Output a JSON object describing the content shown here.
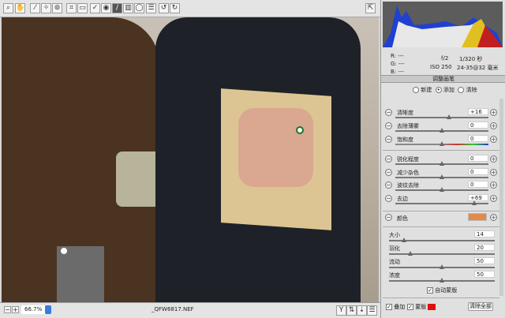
{
  "toolbar": {
    "tools": [
      "zoom",
      "hand",
      "white-balance",
      "color-sampler",
      "targeted-adjustment",
      "crop",
      "straighten",
      "spot-removal",
      "red-eye",
      "adjustment-brush",
      "graduated-filter",
      "radial-filter",
      "preferences",
      "rotate-ccw",
      "rotate-cw"
    ],
    "active": "adjustment-brush"
  },
  "bottom": {
    "zoom": "66.7%",
    "filename": "_QFW6817.NEF"
  },
  "info": {
    "r": "R:",
    "g": "G:",
    "b": "B:",
    "r_val": "---",
    "g_val": "---",
    "b_val": "---",
    "aperture": "f/2",
    "shutter": "1/320 秒",
    "iso": "ISO 250",
    "lens": "24-35@32 毫米"
  },
  "panel": {
    "title": "调整画笔",
    "modes": [
      "新建",
      "添加",
      "清除"
    ],
    "selected_mode": "添加",
    "sliders": [
      {
        "label": "清晰度",
        "value": "+16",
        "pos": 0.58
      },
      {
        "label": "去除薄雾",
        "value": "0",
        "pos": 0.5
      },
      {
        "label": "饱和度",
        "value": "0",
        "pos": 0.5
      },
      {
        "label": "锐化程度",
        "value": "0",
        "pos": 0.5
      },
      {
        "label": "减少杂色",
        "value": "0",
        "pos": 0.5
      },
      {
        "label": "波纹去除",
        "value": "0",
        "pos": 0.5
      },
      {
        "label": "去边",
        "value": "+69",
        "pos": 0.85
      }
    ],
    "color_label": "颜色",
    "color": "#e08a4e",
    "brush": [
      {
        "label": "大小",
        "value": "14",
        "pos": 0.14
      },
      {
        "label": "羽化",
        "value": "20",
        "pos": 0.2
      },
      {
        "label": "流动",
        "value": "50",
        "pos": 0.5
      },
      {
        "label": "浓度",
        "value": "50",
        "pos": 0.5
      }
    ],
    "auto_mask": "自动蒙版",
    "overlay": "叠加",
    "mask": "蒙版",
    "mask_color": "#e01010",
    "clear_all": "清除全部"
  }
}
